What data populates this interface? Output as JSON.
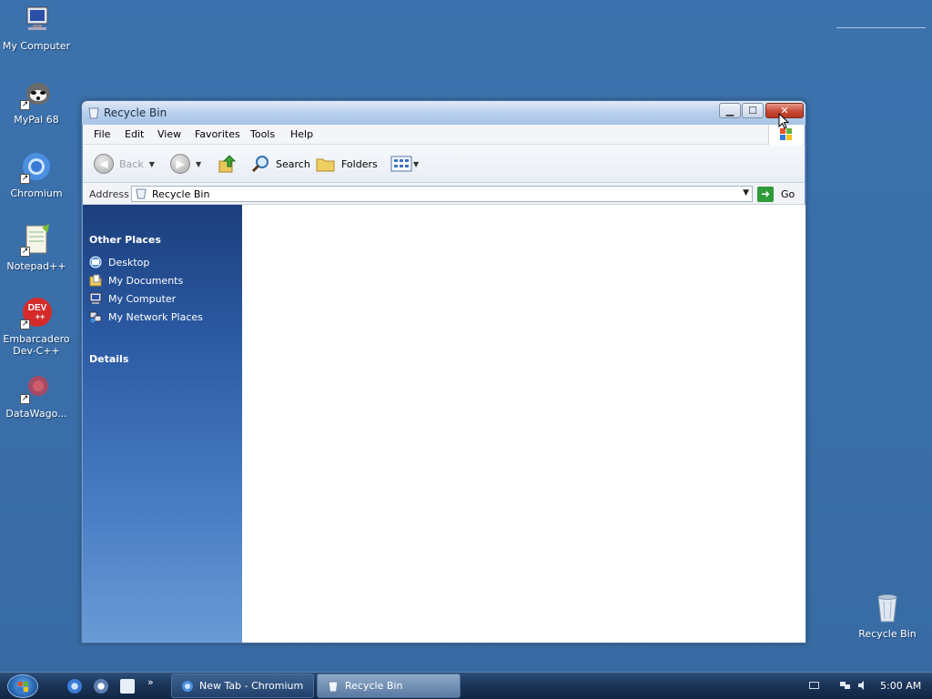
{
  "desktop": {
    "icons": [
      {
        "label": "My Computer"
      },
      {
        "label": "MyPal 68"
      },
      {
        "label": "Chromium"
      },
      {
        "label": "Notepad++"
      },
      {
        "label": "Embarcadero Dev-C++"
      },
      {
        "label": "DataWago..."
      }
    ],
    "dev_badge": "DEV",
    "dev_badge_sub": "++",
    "recycle_bin_label": "Recycle Bin"
  },
  "window": {
    "title": "Recycle Bin",
    "menu": [
      "File",
      "Edit",
      "View",
      "Favorites",
      "Tools",
      "Help"
    ],
    "toolbar": {
      "back": "Back",
      "search": "Search",
      "folders": "Folders"
    },
    "address": {
      "label": "Address",
      "value": "Recycle Bin",
      "go": "Go"
    },
    "taskpane": {
      "other_places_title": "Other Places",
      "other_places": [
        "Desktop",
        "My Documents",
        "My Computer",
        "My Network Places"
      ],
      "details_title": "Details"
    }
  },
  "taskbar": {
    "tasks": [
      {
        "label": "New Tab - Chromium"
      },
      {
        "label": "Recycle Bin"
      }
    ],
    "clock": "5:00 AM"
  },
  "colors": {
    "desktop": "#3a6ea8",
    "taskpane_top": "#1c3e7c",
    "taskbar": "#1b3458",
    "close_button": "#c64b36"
  }
}
